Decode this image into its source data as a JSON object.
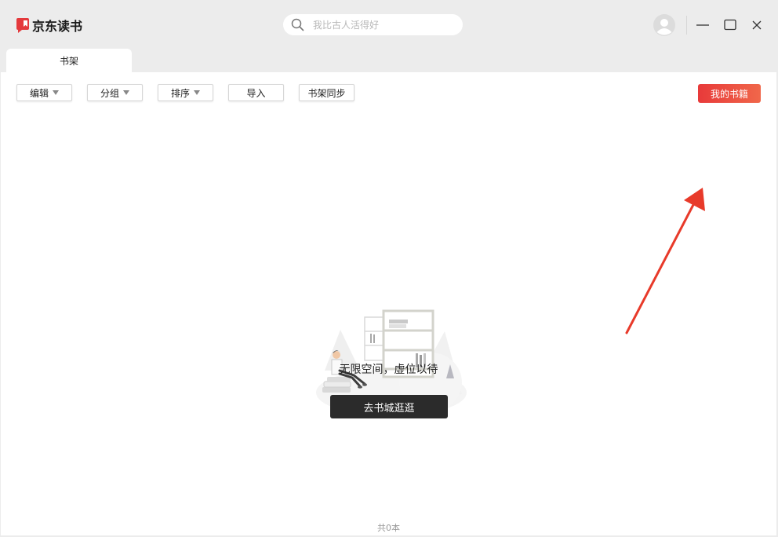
{
  "app": {
    "name": "京东读书",
    "brand_color": "#e4393c"
  },
  "search": {
    "placeholder": "我比古人活得好",
    "icon": "search-icon"
  },
  "window_controls": [
    "minimize-icon",
    "maximize-icon",
    "close-icon"
  ],
  "tabs": [
    {
      "label": "书架",
      "active": true
    }
  ],
  "toolbar": {
    "edit_label": "编辑",
    "group_label": "分组",
    "sort_label": "排序",
    "import_label": "导入",
    "sync_label": "书架同步",
    "my_books_label": "我的书籍"
  },
  "empty_state": {
    "message": "无限空间，虚位以待",
    "button_label": "去书城逛逛"
  },
  "footer": {
    "count_text": "共0本"
  },
  "colors": {
    "accent_start": "#e83a3a",
    "accent_end": "#f0674a",
    "dark_button": "#2b2b2b",
    "annotation_arrow": "#e83a2a"
  }
}
